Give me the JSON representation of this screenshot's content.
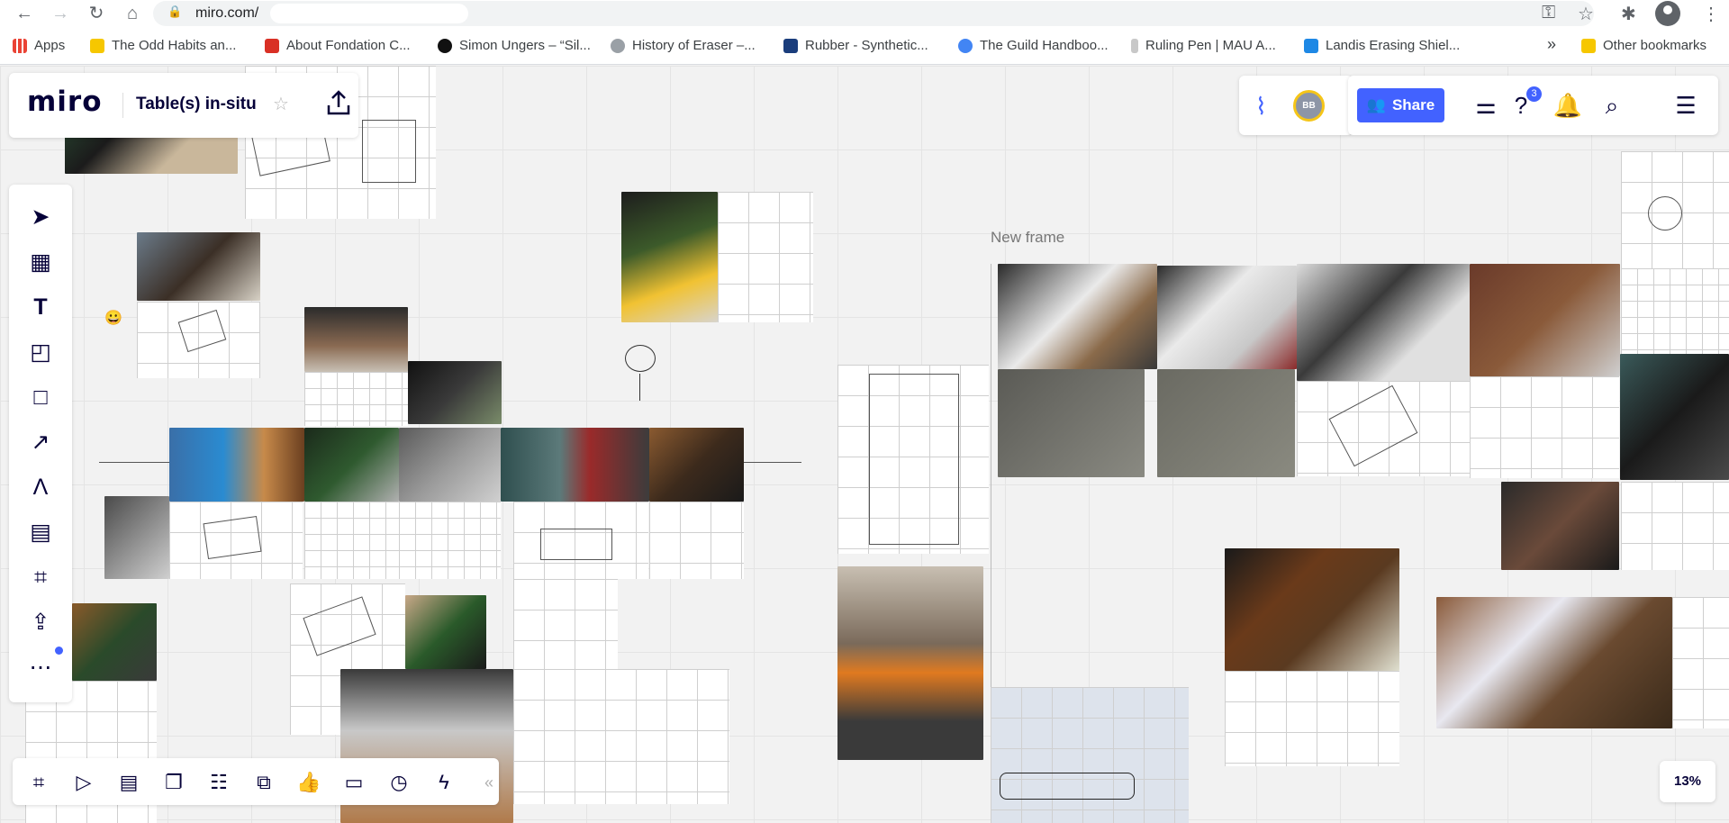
{
  "browser": {
    "url": "miro.com/",
    "bookmarks": [
      {
        "label": "Apps",
        "color": "#ea4335"
      },
      {
        "label": "The Odd Habits an...",
        "color": "#f6c700"
      },
      {
        "label": "About Fondation C...",
        "color": "#d93025"
      },
      {
        "label": "Simon Ungers – “Sil...",
        "color": "#111111"
      },
      {
        "label": "History of Eraser –...",
        "color": "#9aa0a6"
      },
      {
        "label": "Rubber - Synthetic...",
        "color": "#1a3d7c"
      },
      {
        "label": "The Guild Handboo...",
        "color": "#4285f4"
      },
      {
        "label": "Ruling Pen | MAU A...",
        "color": "#c8c8c8"
      },
      {
        "label": "Landis Erasing Shiel...",
        "color": "#1e88e5"
      }
    ],
    "bookmarks_more": "»",
    "other_bookmarks": "Other bookmarks"
  },
  "board": {
    "logo": "miro",
    "name": "Table(s) in-situ",
    "star_icon": "star-icon",
    "share_label": "Share",
    "avatar_initials": "BB",
    "help_badge": "3",
    "zoom": "13%",
    "frame_title": "New frame"
  },
  "toolbar": {
    "tools": [
      "select-icon",
      "templates-icon",
      "text-icon",
      "sticky-note-icon",
      "shape-icon",
      "connection-line-icon",
      "pen-icon",
      "comment-icon",
      "frame-icon",
      "upload-icon",
      "more-icon"
    ]
  },
  "bottom_toolbar": {
    "tools": [
      "frames-icon",
      "presentation-icon",
      "chat-icon",
      "cards-icon",
      "kanban-icon",
      "embed-icon",
      "voting-icon",
      "video-call-icon",
      "timer-icon",
      "lightning-icon",
      "collapse-icon"
    ]
  },
  "colors": {
    "accent": "#4262ff",
    "canvas": "#f2f2f2",
    "avatar_ring": "#f5c518"
  }
}
